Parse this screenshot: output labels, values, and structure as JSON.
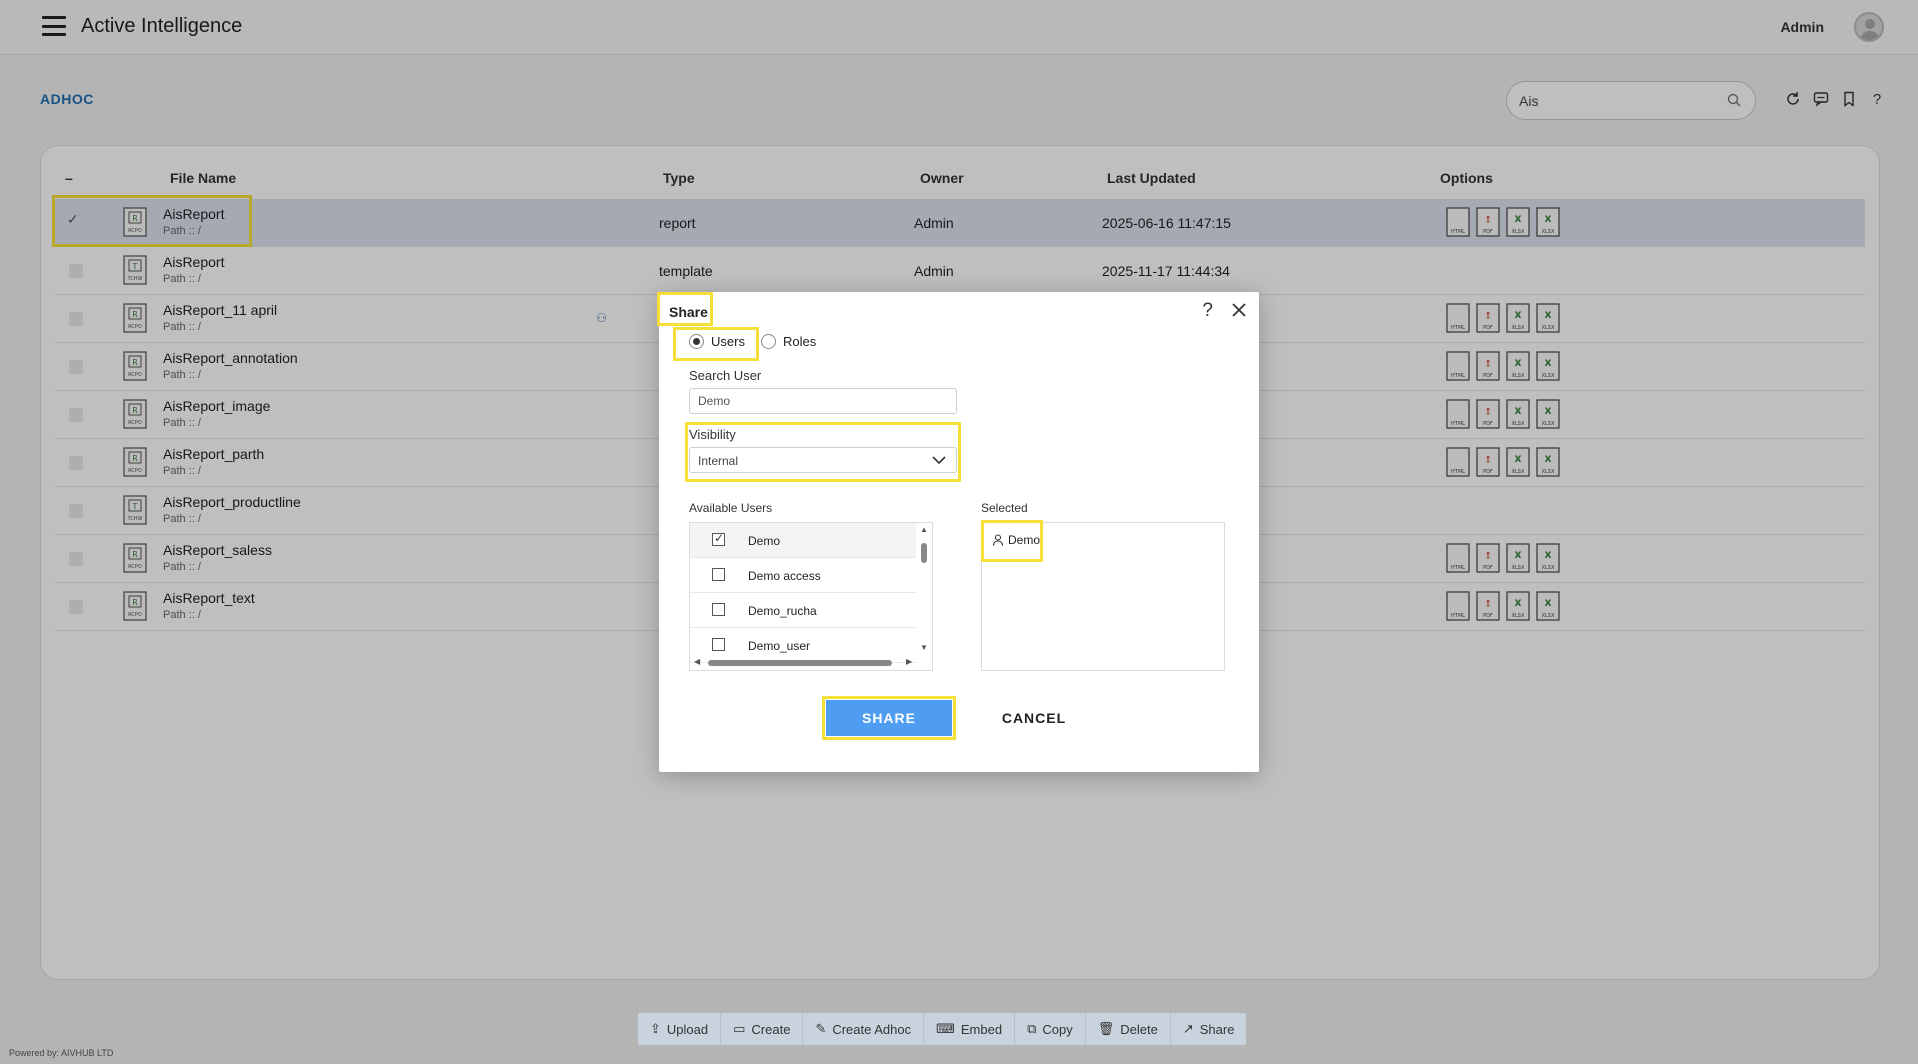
{
  "header": {
    "title": "Active Intelligence",
    "user": "Admin"
  },
  "breadcrumb": "ADHOC",
  "search": {
    "value": "Ais"
  },
  "table": {
    "columns": [
      "File Name",
      "Type",
      "Owner",
      "Last Updated",
      "Options"
    ],
    "select_all_symbol": "–",
    "path_prefix": "Path :: /",
    "rows": [
      {
        "name": "AisReport",
        "type": "report",
        "owner": "Admin",
        "updated": "2025-06-16 11:47:15",
        "kind": "report",
        "selected": true
      },
      {
        "name": "AisReport",
        "type": "template",
        "owner": "Admin",
        "updated": "2025-11-17 11:44:34",
        "kind": "template",
        "selected": false
      },
      {
        "name": "AisReport_11 april",
        "type": "",
        "owner": "",
        "updated": "",
        "kind": "report",
        "selected": false
      },
      {
        "name": "AisReport_annotation",
        "type": "",
        "owner": "",
        "updated": "",
        "kind": "report",
        "selected": false
      },
      {
        "name": "AisReport_image",
        "type": "",
        "owner": "",
        "updated": "",
        "kind": "report",
        "selected": false
      },
      {
        "name": "AisReport_parth",
        "type": "",
        "owner": "",
        "updated": "",
        "kind": "report",
        "selected": false
      },
      {
        "name": "AisReport_productline",
        "type": "",
        "owner": "",
        "updated": "",
        "kind": "template",
        "selected": false
      },
      {
        "name": "AisReport_saless",
        "type": "",
        "owner": "",
        "updated": "",
        "kind": "report",
        "selected": false
      },
      {
        "name": "AisReport_text",
        "type": "",
        "owner": "",
        "updated": "",
        "kind": "report",
        "selected": false
      }
    ]
  },
  "modal": {
    "title": "Share",
    "radio_users": "Users",
    "radio_roles": "Roles",
    "search_label": "Search User",
    "search_value": "Demo",
    "visibility_label": "Visibility",
    "visibility_value": "Internal",
    "available_label": "Available Users",
    "selected_label": "Selected",
    "available_users": [
      {
        "name": "Demo",
        "checked": true
      },
      {
        "name": "Demo access",
        "checked": false
      },
      {
        "name": "Demo_rucha",
        "checked": false
      },
      {
        "name": "Demo_user",
        "checked": false
      }
    ],
    "selected_users": [
      "Demo"
    ],
    "share_button": "SHARE",
    "cancel_button": "CANCEL"
  },
  "toolbar": {
    "upload": "Upload",
    "create": "Create",
    "create_adhoc": "Create Adhoc",
    "embed": "Embed",
    "copy": "Copy",
    "delete": "Delete",
    "share": "Share"
  },
  "footer": {
    "powered": "Powered by: AIVHUB LTD"
  },
  "colors": {
    "accent": "#4f9df3",
    "highlight": "#f5e03a",
    "link": "#1f6fb2"
  }
}
